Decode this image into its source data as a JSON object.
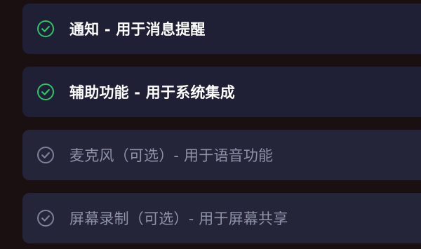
{
  "permissions": [
    {
      "label": "通知 - 用于消息提醒",
      "status": "granted",
      "icon": "check-circle-icon"
    },
    {
      "label": "辅助功能 - 用于系统集成",
      "status": "granted",
      "icon": "check-circle-icon"
    },
    {
      "label": "麦克风（可选）- 用于语音功能",
      "status": "optional",
      "icon": "check-circle-icon"
    },
    {
      "label": "屏幕录制（可选）- 用于屏幕共享",
      "status": "optional",
      "icon": "check-circle-icon"
    }
  ],
  "colors": {
    "granted_check": "#2fc26b",
    "optional_check": "#7d8196",
    "card_background": "#1f1f33",
    "page_background": "#1a1012"
  }
}
